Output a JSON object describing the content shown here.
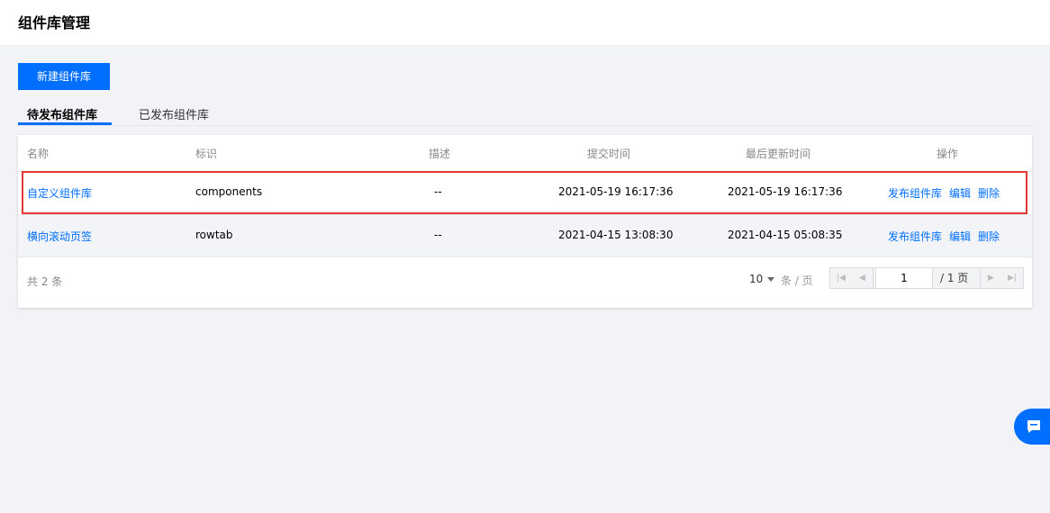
{
  "page": {
    "title": "组件库管理"
  },
  "toolbar": {
    "new_label": "新建组件库"
  },
  "tabs": [
    {
      "label": "待发布组件库",
      "active": true
    },
    {
      "label": "已发布组件库",
      "active": false
    }
  ],
  "table": {
    "columns": [
      "名称",
      "标识",
      "描述",
      "提交时间",
      "最后更新时间",
      "操作"
    ],
    "rows": [
      {
        "name": "自定义组件库",
        "id": "components",
        "desc": "--",
        "submitted": "2021-05-19 16:17:36",
        "updated": "2021-05-19 16:17:36",
        "actions": [
          "发布组件库",
          "编辑",
          "删除"
        ]
      },
      {
        "name": "横向滚动页签",
        "id": "rowtab",
        "desc": "--",
        "submitted": "2021-04-15 13:08:30",
        "updated": "2021-04-15 05:08:35",
        "actions": [
          "发布组件库",
          "编辑",
          "删除"
        ]
      }
    ]
  },
  "footer": {
    "total": "共 2 条",
    "page_size": "10",
    "per_page_label": "条 / 页",
    "current_page": "1",
    "total_pages": "/ 1 页"
  },
  "colors": {
    "accent": "#006eff",
    "highlight": "#e53935"
  }
}
